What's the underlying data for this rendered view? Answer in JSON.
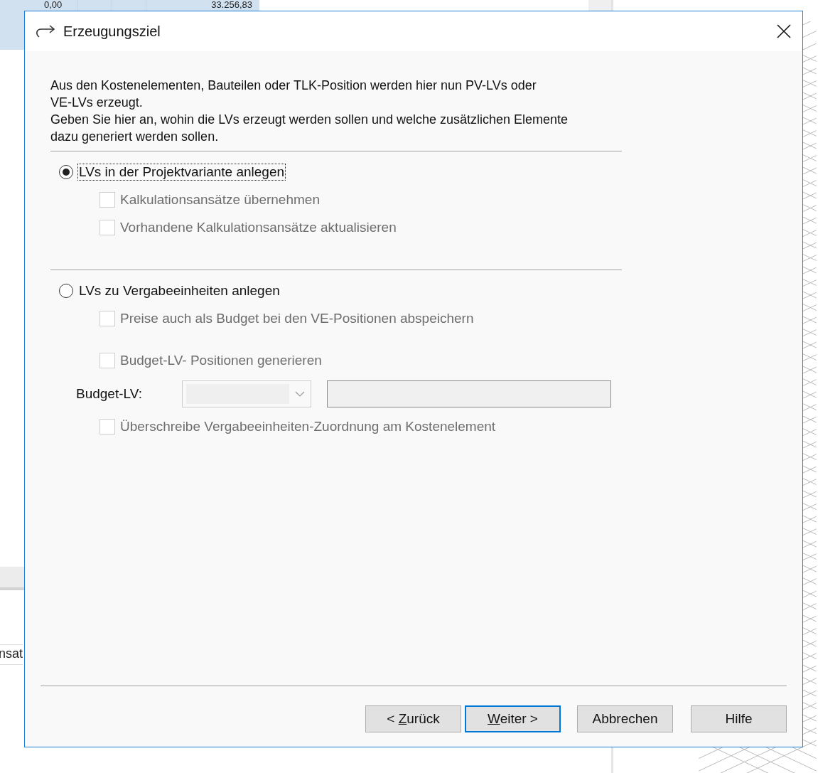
{
  "background": {
    "cells": [
      "0,00",
      "33.256,83"
    ],
    "side_text": "nsat"
  },
  "dialog": {
    "title": "Erzeugungsziel",
    "intro": [
      "Aus den Kostenelementen, Bauteilen oder TLK-Position werden hier nun PV-LVs oder\nVE-LVs erzeugt.",
      "Geben Sie hier an, wohin die LVs erzeugt werden sollen und welche zusätzlichen Elemente\ndazu generiert werden sollen."
    ],
    "groups": [
      {
        "radio": {
          "label": "LVs in der Projektvariante anlegen",
          "selected": true,
          "focused": true
        },
        "items": [
          {
            "kind": "checkbox",
            "label": "Kalkulationsansätze übernehmen",
            "checked": false,
            "disabled": true
          },
          {
            "kind": "checkbox",
            "label": "Vorhandene Kalkulationsansätze aktualisieren",
            "checked": false,
            "disabled": true
          }
        ]
      },
      {
        "radio": {
          "label": "LVs zu Vergabeeinheiten anlegen",
          "selected": false,
          "focused": false
        },
        "items": [
          {
            "kind": "checkbox",
            "label": "Preise auch als Budget bei den VE-Positionen abspeichern",
            "checked": false,
            "disabled": true
          },
          {
            "kind": "checkbox",
            "label": "Budget-LV- Positionen generieren",
            "checked": false,
            "disabled": true
          },
          {
            "kind": "field_row",
            "label": "Budget-LV:",
            "disabled": true
          },
          {
            "kind": "checkbox",
            "label": "Überschreibe Vergabeeinheiten-Zuordnung am Kostenelement",
            "checked": false,
            "disabled": true
          }
        ]
      }
    ],
    "buttons": [
      {
        "label": "< ",
        "mnemonic": "Z",
        "rest": "urück",
        "default": false
      },
      {
        "mnemonic": "W",
        "rest": "eiter >",
        "default": true
      },
      {
        "label": "Abbrechen",
        "default": false
      },
      {
        "label": "Hilfe",
        "default": false
      }
    ]
  }
}
